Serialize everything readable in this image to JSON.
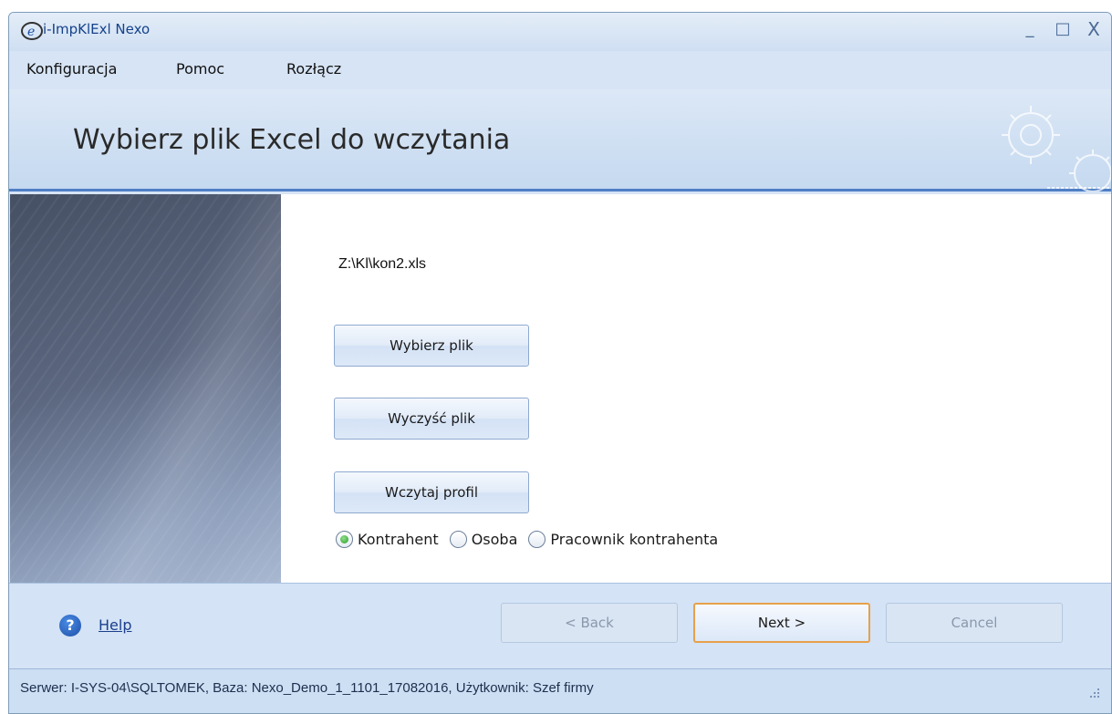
{
  "window": {
    "title": "i-ImpKlExl Nexo",
    "controls": {
      "minimize": "_",
      "maximize": "□",
      "close": "X"
    }
  },
  "menu": [
    {
      "label": "Konfiguracja"
    },
    {
      "label": "Pomoc"
    },
    {
      "label": "Rozłącz"
    }
  ],
  "header": {
    "title": "Wybierz plik Excel do wczytania"
  },
  "content": {
    "file_path": "Z:\\Kl\\kon2.xls",
    "buttons": {
      "choose": "Wybierz plik",
      "clear": "Wyczyść plik",
      "load_profile": "Wczytaj profil"
    },
    "radios": [
      {
        "label": "Kontrahent",
        "checked": true
      },
      {
        "label": "Osoba",
        "checked": false
      },
      {
        "label": "Pracownik kontrahenta",
        "checked": false
      }
    ]
  },
  "footer": {
    "help_label": "Help",
    "back_label": "<  Back",
    "next_label": "Next  >",
    "cancel_label": "Cancel"
  },
  "status": {
    "text": "Serwer: I-SYS-04\\SQLTOMEK, Baza: Nexo_Demo_1_1101_17082016, Użytkownik: Szef firmy"
  },
  "colors": {
    "accent": "#4f7fc5",
    "focus_border": "#e8a04a",
    "help_icon": "#1d4fa6"
  },
  "icons": [
    "app-logo-icon",
    "gear-icon",
    "help-icon",
    "resize-grip-icon"
  ]
}
